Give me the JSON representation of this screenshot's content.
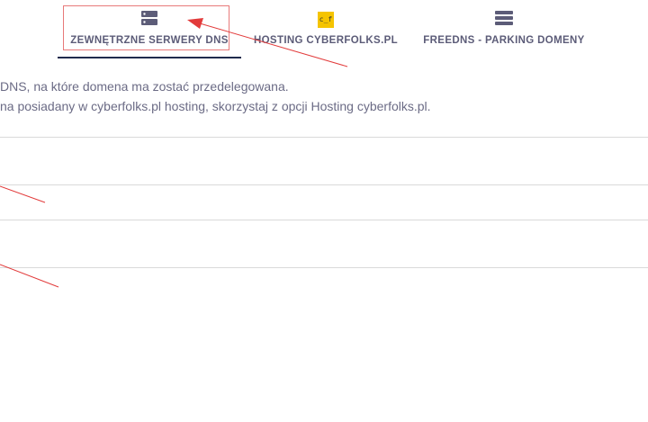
{
  "tabs": [
    {
      "label": "ZEWNĘTRZNE SERWERY DNS",
      "icon": "server-icon",
      "active": true
    },
    {
      "label": "HOSTING CYBERFOLKS.PL",
      "icon": "cyberfolks-logo-icon",
      "logo_text": "c_f",
      "active": false
    },
    {
      "label": "FREEDNS - PARKING DOMENY",
      "icon": "list-icon",
      "active": false
    }
  ],
  "description": {
    "line1": "DNS, na które domena ma zostać przedelegowana.",
    "line2": "na posiadany w cyberfolks.pl hosting, skorzystaj z opcji Hosting cyberfolks.pl."
  },
  "colors": {
    "accent_underline": "#1f2b4d",
    "annotation_red": "#e23b3b",
    "logo_yellow": "#f5c400",
    "text": "#6b6b85",
    "divider": "#d9d9d9"
  }
}
